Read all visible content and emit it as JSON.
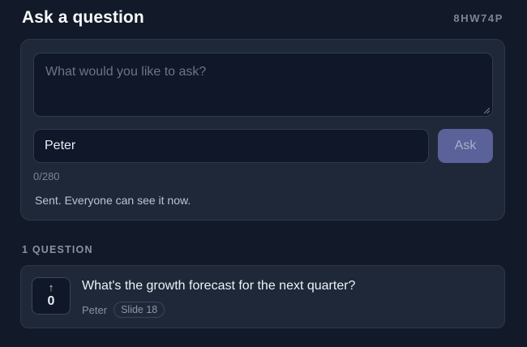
{
  "header": {
    "title": "Ask a question",
    "room_code": "8HW74P"
  },
  "form": {
    "question_placeholder": "What would you like to ask?",
    "question_value": "",
    "name_value": "Peter",
    "ask_label": "Ask",
    "char_count": "0/280",
    "status_message": "Sent. Everyone can see it now."
  },
  "questions_section": {
    "label": "1 QUESTION",
    "items": [
      {
        "text": "What's the growth forecast for the next quarter?",
        "author": "Peter",
        "slide": "Slide 18",
        "votes": "0"
      }
    ]
  },
  "icons": {
    "upvote": "arrow-up-icon"
  },
  "colors": {
    "background": "#121a29",
    "card": "#1e2838",
    "ask_button": "#5b6299"
  }
}
